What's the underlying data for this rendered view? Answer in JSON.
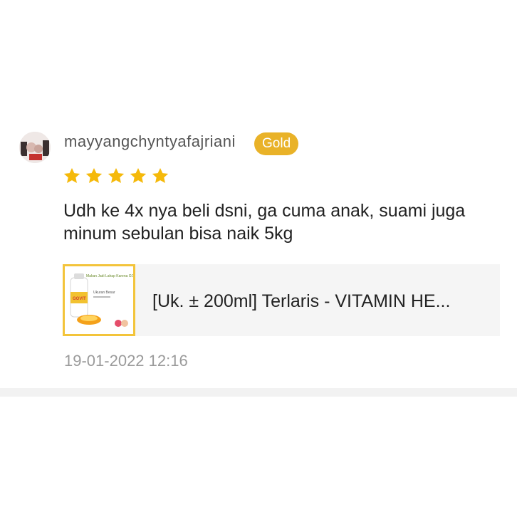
{
  "review": {
    "username": "mayyangchyntyafajriani",
    "badge": "Gold",
    "rating": 5,
    "rating_max": 5,
    "text": "Udh ke 4x nya beli dsni, ga cuma anak, suami juga minum sebulan bisa naik 5kg",
    "timestamp": "19-01-2022 12:16"
  },
  "product": {
    "title": "[Uk. ± 200ml] Terlaris - VITAMIN HE...",
    "thumb_headline": "Makan Jadi Lahap Karena GOVIT",
    "thumb_brand": "GOVIT",
    "thumb_size_label": "Ukuran Besar"
  },
  "colors": {
    "star": "#f5b90a",
    "badge": "#e9b228",
    "thumb_border": "#f3c43a"
  }
}
